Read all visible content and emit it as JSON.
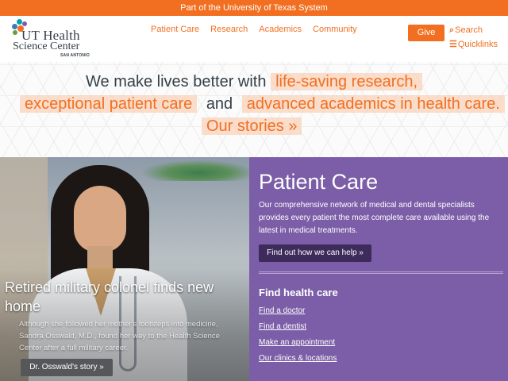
{
  "topbar": {
    "text": "Part of the University of Texas System"
  },
  "logo": {
    "line1": "UT Health",
    "line2": "Science Center",
    "line3": "San Antonio",
    "colors": [
      "#f26f21",
      "#3d7ab8",
      "#6a9c3b",
      "#7b5ea7",
      "#00a3ad"
    ]
  },
  "nav": {
    "items": [
      "Patient Care",
      "Research",
      "Academics",
      "Community"
    ]
  },
  "utility": {
    "give_label": "Give",
    "search_label": "Search",
    "search_icon": "search-icon",
    "quicklinks_label": "Quicklinks",
    "quicklinks_icon": "menu-icon"
  },
  "hero": {
    "lead": "We make lives better with",
    "phrase1": "life-saving research,",
    "phrase2": "exceptional patient care",
    "connector": "and",
    "phrase3": "advanced academics in health care.",
    "cta": "Our stories »"
  },
  "story": {
    "title": "Retired military colonel finds new home",
    "text": "Although she followed her mother's footsteps into medicine, Sandra Osswald, M.D., found her way to the Health Science Center after a full military career.",
    "button": "Dr. Osswald's story »"
  },
  "care": {
    "title": "Patient Care",
    "text": "Our comprehensive network of medical and dental specialists provides every patient the most complete care available using the latest in medical treatments.",
    "button": "Find out how we can help »",
    "find_title": "Find health care",
    "links": [
      "Find a doctor",
      "Find a dentist",
      "Make an appointment",
      "Our clinics & locations"
    ]
  },
  "colors": {
    "brand_orange": "#f26f21",
    "purple": "#7b5ea7",
    "dark_purple": "#3d2b5c",
    "text_dark": "#333f48"
  }
}
